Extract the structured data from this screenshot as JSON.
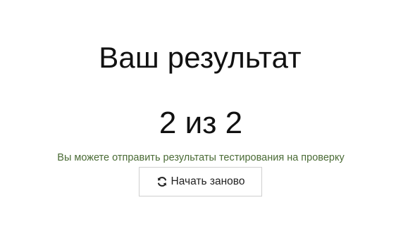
{
  "result": {
    "title": "Ваш результат",
    "score_text": "2 из 2",
    "hint": "Вы можете отправить результаты тестирования на проверку"
  },
  "actions": {
    "restart_label": "Начать заново",
    "restart_icon": "refresh-icon"
  }
}
